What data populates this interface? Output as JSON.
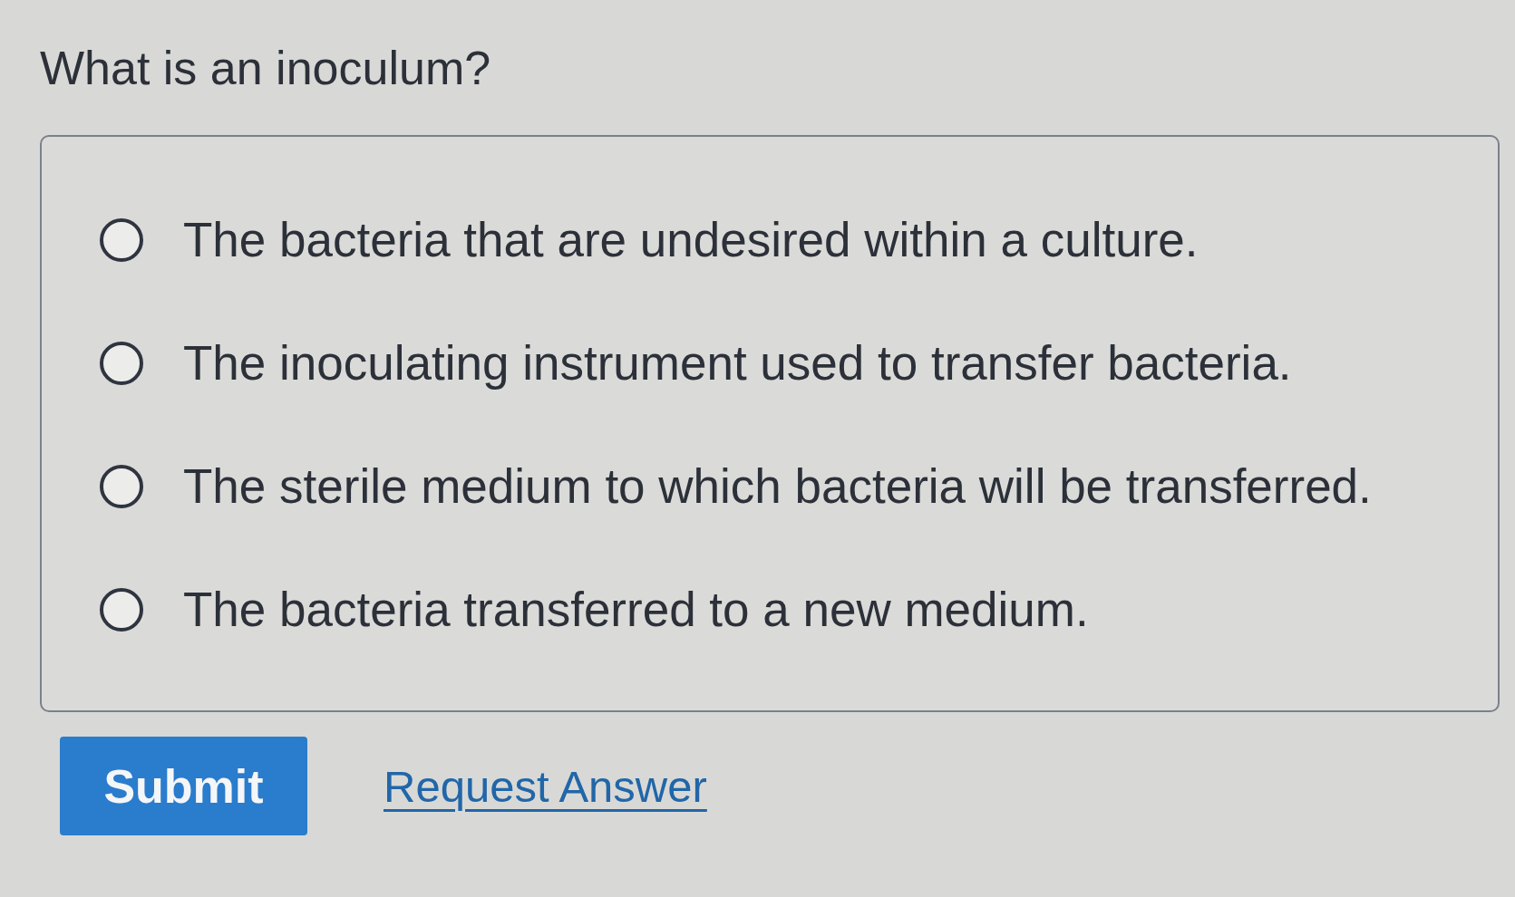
{
  "question": "What is an inoculum?",
  "options": [
    {
      "label": "The bacteria that are undesired within a culture.",
      "selected": false
    },
    {
      "label": "The inoculating instrument used to transfer bacteria.",
      "selected": false
    },
    {
      "label": "The sterile medium to which bacteria will be transferred.",
      "selected": false
    },
    {
      "label": "The bacteria transferred to a new medium.",
      "selected": false
    }
  ],
  "actions": {
    "submit": "Submit",
    "request_answer": "Request Answer"
  }
}
